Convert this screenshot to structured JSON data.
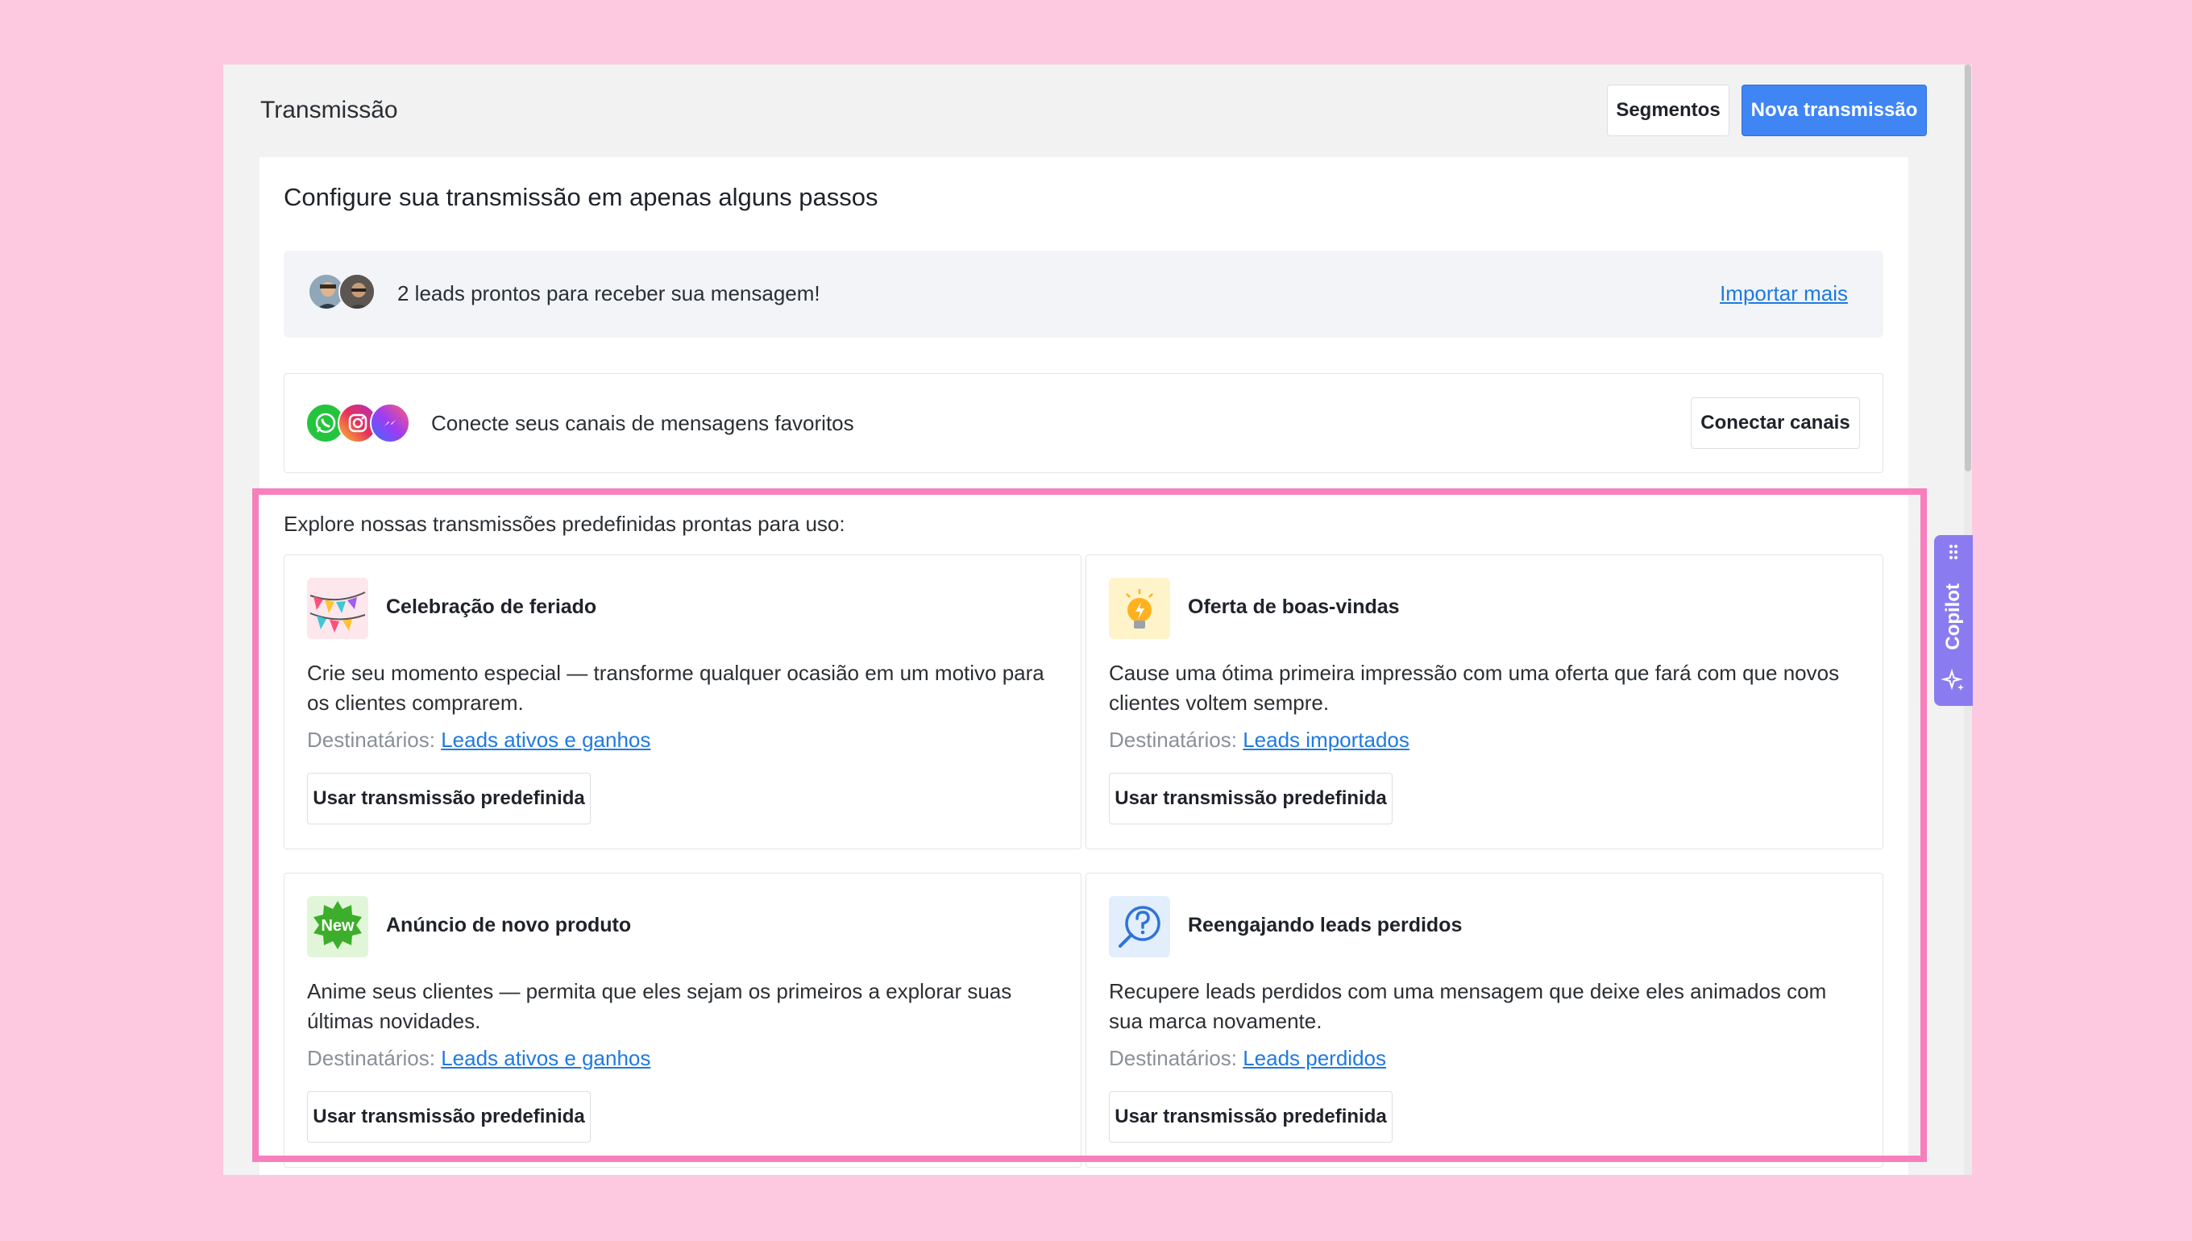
{
  "header": {
    "title": "Transmissão",
    "segments_label": "Segmentos",
    "new_label": "Nova transmissão"
  },
  "panel": {
    "title": "Configure sua transmissão em apenas alguns passos",
    "leads_text": "2 leads prontos para receber sua mensagem!",
    "import_link": "Importar mais",
    "channels_text": "Conecte seus canais de mensagens favoritos",
    "connect_label": "Conectar canais",
    "explore_text": "Explore nossas transmissões predefinidas prontas para uso:"
  },
  "recipients_label": "Destinatários:",
  "cards": [
    {
      "icon": "bunting-flags-icon",
      "title": "Celebração de feriado",
      "description": "Crie seu momento especial — transforme qualquer ocasião em um motivo para os clientes comprarem.",
      "recipients": "Leads ativos e ganhos",
      "button": "Usar transmissão predefinida"
    },
    {
      "icon": "lightbulb-icon",
      "title": "Oferta de boas-vindas",
      "description": "Cause uma ótima primeira impressão com uma oferta que fará com que novos clientes voltem sempre.",
      "recipients": "Leads importados",
      "button": "Usar transmissão predefinida"
    },
    {
      "icon": "new-badge-icon",
      "icon_text": "New",
      "title": "Anúncio de novo produto",
      "description": "Anime seus clientes — permita que eles sejam os primeiros a explorar suas últimas novidades.",
      "recipients": "Leads ativos e ganhos",
      "button": "Usar transmissão predefinida"
    },
    {
      "icon": "question-search-icon",
      "title": "Reengajando leads perdidos",
      "description": "Recupere leads perdidos com uma mensagem que deixe eles animados com sua marca novamente.",
      "recipients": "Leads perdidos",
      "button": "Usar transmissão predefinida"
    }
  ],
  "copilot": {
    "label": "Copilot"
  },
  "colors": {
    "background": "#fdc9e0",
    "accent": "#3f86f4",
    "link": "#1f7ae0",
    "highlight": "#f77fbb",
    "copilot": "#8a7cf0"
  }
}
